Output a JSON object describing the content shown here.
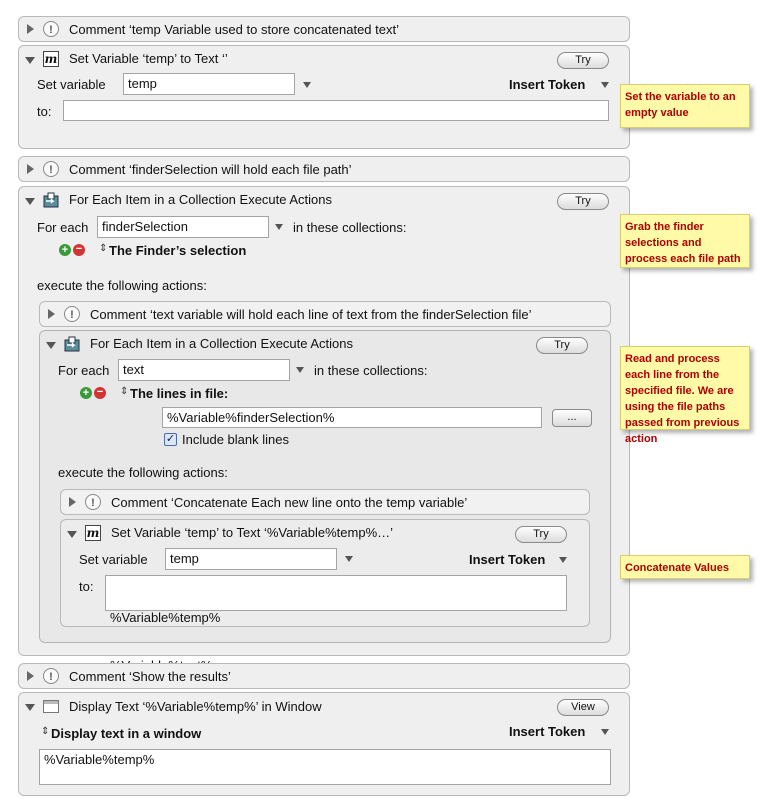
{
  "comment1": "Comment ‘temp Variable used to store concatenated text’",
  "setvar1": {
    "title": "Set Variable ‘temp’ to Text ‘’",
    "try": "Try",
    "set_label": "Set variable",
    "var_value": "temp",
    "insert_token": "Insert Token",
    "to_label": "to:",
    "to_value": ""
  },
  "note1": "Set the variable to an empty value",
  "comment2": "Comment ‘finderSelection will hold each file path’",
  "foreach1": {
    "title": "For Each Item in a Collection Execute Actions",
    "try": "Try",
    "for_each_label": "For each",
    "var_value": "finderSelection",
    "collections_label": "in these collections:",
    "collection": "The Finder’s selection",
    "execute_label": "execute the following actions:"
  },
  "note2": "Grab the finder selections and process each file path",
  "comment3": "Comment ‘text variable will hold each line of text from the finderSelection file’",
  "foreach2": {
    "title": "For Each Item in a Collection Execute Actions",
    "try": "Try",
    "for_each_label": "For each",
    "var_value": "text",
    "collections_label": "in these collections:",
    "collection": "The lines in file:",
    "file_path": "%Variable%finderSelection%",
    "browse": "...",
    "include_blank": "Include blank lines",
    "execute_label": "execute the following actions:"
  },
  "note3": "Read and process each line from the specified file. We are using the file paths passed from previous action",
  "comment4": "Comment ‘Concatenate Each new line onto the temp variable’",
  "setvar2": {
    "title": "Set Variable ‘temp’ to Text ‘%Variable%temp%…’",
    "try": "Try",
    "set_label": "Set variable",
    "var_value": "temp",
    "insert_token": "Insert Token",
    "to_label": "to:",
    "to_line1": "%Variable%temp%",
    "to_line2": "%Variable%text%"
  },
  "note4": "Concatenate Values",
  "comment5": "Comment ‘Show the results’",
  "display": {
    "title": "Display Text ‘%Variable%temp%’ in Window",
    "view": "View",
    "mode": "Display text in a window",
    "insert_token": "Insert Token",
    "text_value": "%Variable%temp%"
  },
  "icons": {
    "comment": "exclamation-icon",
    "set_variable": "macro-variable-icon",
    "for_each": "loop-icon",
    "display": "window-icon"
  }
}
